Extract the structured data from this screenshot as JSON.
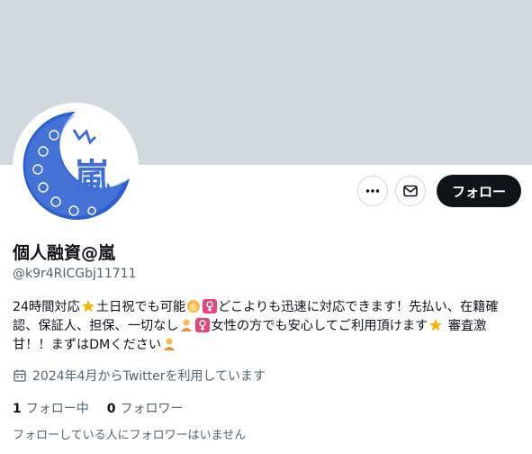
{
  "profile": {
    "display_name": "個人融資@嵐",
    "handle": "@k9r4RICGbj11711",
    "bio": {
      "seg1": "24時間対応",
      "seg2": "土日祝でも可能",
      "seg3": "どこよりも迅速に対応できます！先払い、在籍確認、保証人、担保、一切なし",
      "seg4": "女性の方でも安心してご利用頂けます",
      "seg5": " 審査激甘！！まずはDMください"
    },
    "joined": "2024年4月からTwitterを利用しています",
    "following_count": "1",
    "following_label": "フォロー中",
    "followers_count": "0",
    "followers_label": "フォロワー",
    "no_mutual_followers": "フォローしている人にフォロワーはいません"
  },
  "actions": {
    "follow_label": "フォロー"
  },
  "icons": [
    "more-icon",
    "mail-icon",
    "calendar-icon",
    "star-emoji",
    "face-emoji",
    "female-sign-emoji",
    "person-bowing-emoji"
  ],
  "colors": {
    "banner": "#cfd9de",
    "follow_button": "#0f1419",
    "secondary_text": "#536471"
  }
}
